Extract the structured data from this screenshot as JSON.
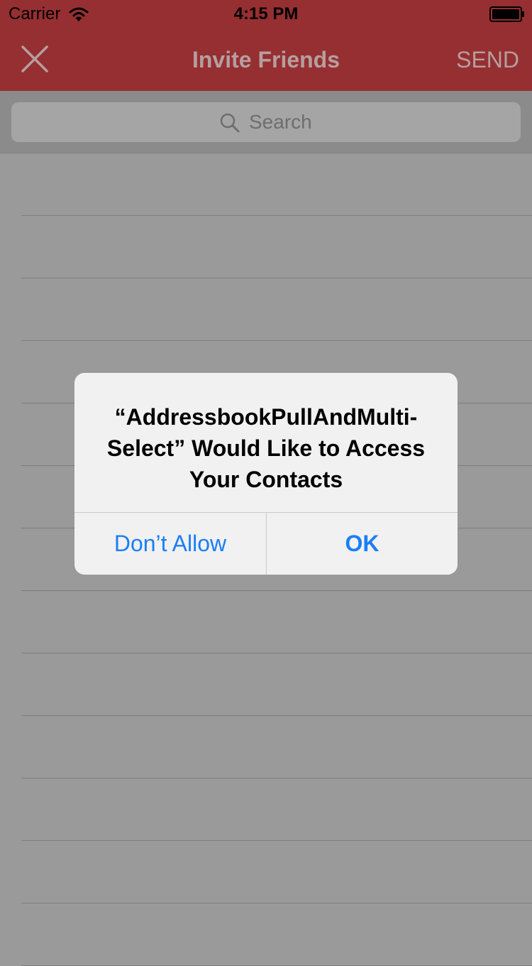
{
  "status_bar": {
    "carrier": "Carrier",
    "time": "4:15 PM",
    "wifi_icon": "wifi-icon",
    "battery_icon": "battery-icon"
  },
  "nav_bar": {
    "close_icon": "close-icon",
    "title": "Invite Friends",
    "send_label": "SEND",
    "background_color": "#962f31"
  },
  "search": {
    "icon": "search-icon",
    "placeholder": "Search"
  },
  "contact_list": {
    "rows": [
      "",
      "",
      "",
      "",
      "",
      "",
      "",
      "",
      "",
      "",
      "",
      "",
      ""
    ]
  },
  "alert": {
    "title": "“AddressbookPullAndMulti-Select” Would Like to Access Your Contacts",
    "dont_allow_label": "Don’t Allow",
    "ok_label": "OK",
    "button_color": "#1a7ef6"
  }
}
